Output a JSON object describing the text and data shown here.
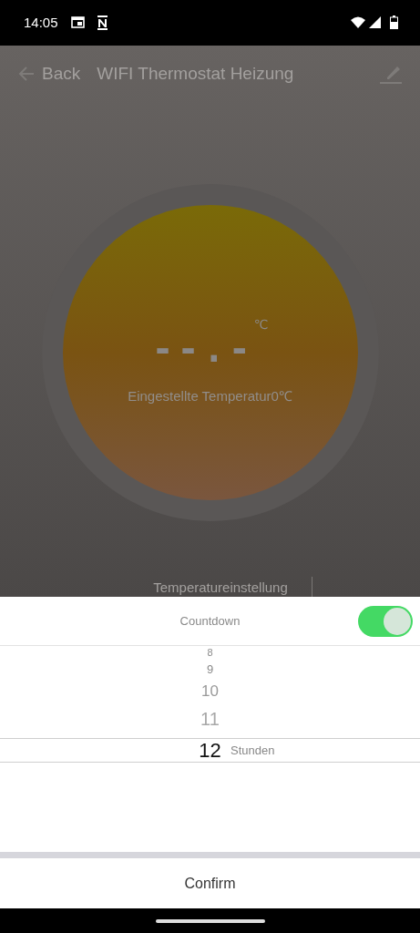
{
  "status_bar": {
    "time": "14:05"
  },
  "header": {
    "back_label": "Back",
    "title": "WIFI Thermostat Heizung"
  },
  "dial": {
    "reading": "--.-",
    "unit": "℃",
    "set_temperature": "Eingestellte Temperatur0℃"
  },
  "section_label": "Temperatureinstellung",
  "sheet": {
    "title": "Countdown",
    "toggle_on": true,
    "picker": {
      "unit": "Stunden",
      "items": [
        {
          "label": "8",
          "selected": false
        },
        {
          "label": "9",
          "selected": false
        },
        {
          "label": "10",
          "selected": false
        },
        {
          "label": "11",
          "selected": false
        },
        {
          "label": "12",
          "selected": true
        }
      ]
    },
    "confirm": "Confirm"
  }
}
